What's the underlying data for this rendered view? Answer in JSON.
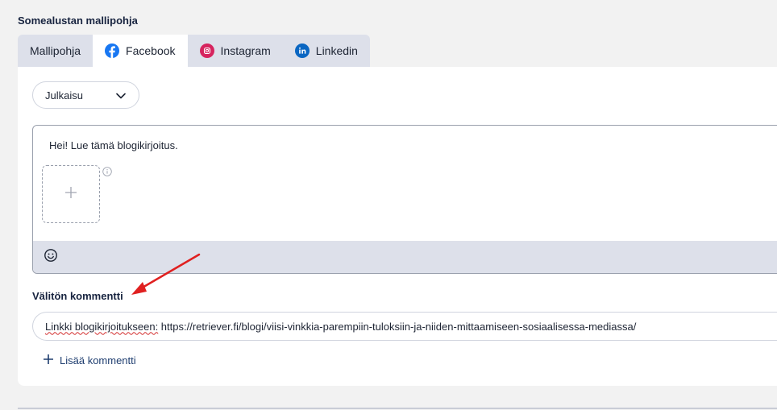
{
  "section": {
    "title": "Somealustan mallipohja"
  },
  "tabs": [
    {
      "label": "Mallipohja",
      "icon": "none",
      "active": false
    },
    {
      "label": "Facebook",
      "icon": "facebook-icon",
      "active": true,
      "color": "#1877f2"
    },
    {
      "label": "Instagram",
      "icon": "instagram-icon",
      "active": false,
      "color": "#e1306c"
    },
    {
      "label": "Linkedin",
      "icon": "linkedin-icon",
      "active": false,
      "color": "#0a66c2"
    }
  ],
  "post_type": {
    "selected": "Julkaisu"
  },
  "editor": {
    "text": "Hei! Lue tämä blogikirjoitus."
  },
  "comment": {
    "label": "Välitön kommentti",
    "value_prefix": "Linkki blogikirjoitukseen:",
    "value_url": " https://retriever.fi/blogi/viisi-vinkkia-parempiin-tuloksiin-ja-niiden-mittaamiseen-sosiaalisessa-mediassa/"
  },
  "add_comment": {
    "label": "Lisää kommentti"
  },
  "colors": {
    "accent": "#1e3d6f",
    "annotation_arrow": "#e02020"
  }
}
